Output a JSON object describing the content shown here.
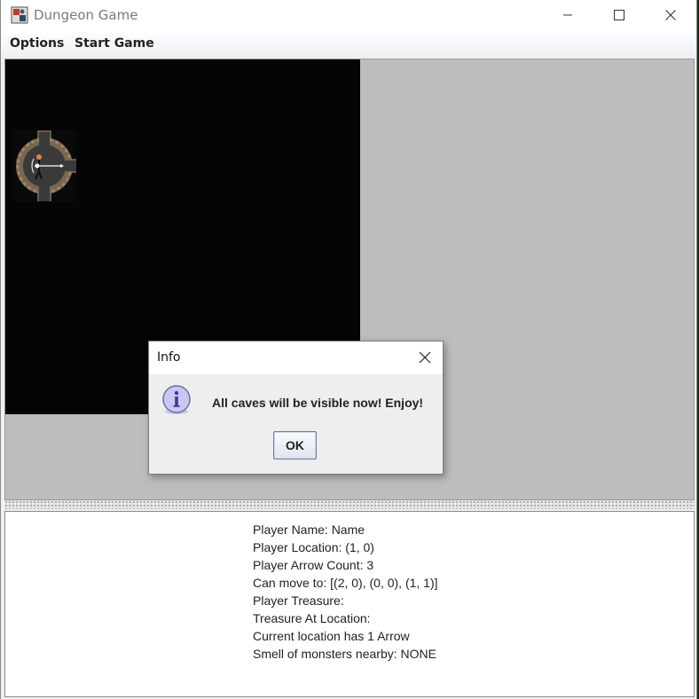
{
  "window": {
    "title": "Dungeon Game"
  },
  "menu": [
    {
      "label": "Options"
    },
    {
      "label": "Start Game"
    }
  ],
  "info_panel": {
    "lines": [
      "Player Name: Name",
      "Player Location: (1, 0)",
      "Player Arrow Count: 3",
      "Can move to: [(2, 0), (0, 0), (1, 1)]",
      "Player Treasure:",
      "Treasure At Location:",
      "Current location has 1 Arrow",
      "Smell of monsters nearby: NONE"
    ]
  },
  "dialog": {
    "title": "Info",
    "icon": "info-icon",
    "message": "All caves will be visible now! Enjoy!",
    "ok_label": "OK"
  },
  "colors": {
    "dungeon_bg": "#050505",
    "content_bg": "#bdbdbd",
    "title_text": "#7a7a7a"
  }
}
